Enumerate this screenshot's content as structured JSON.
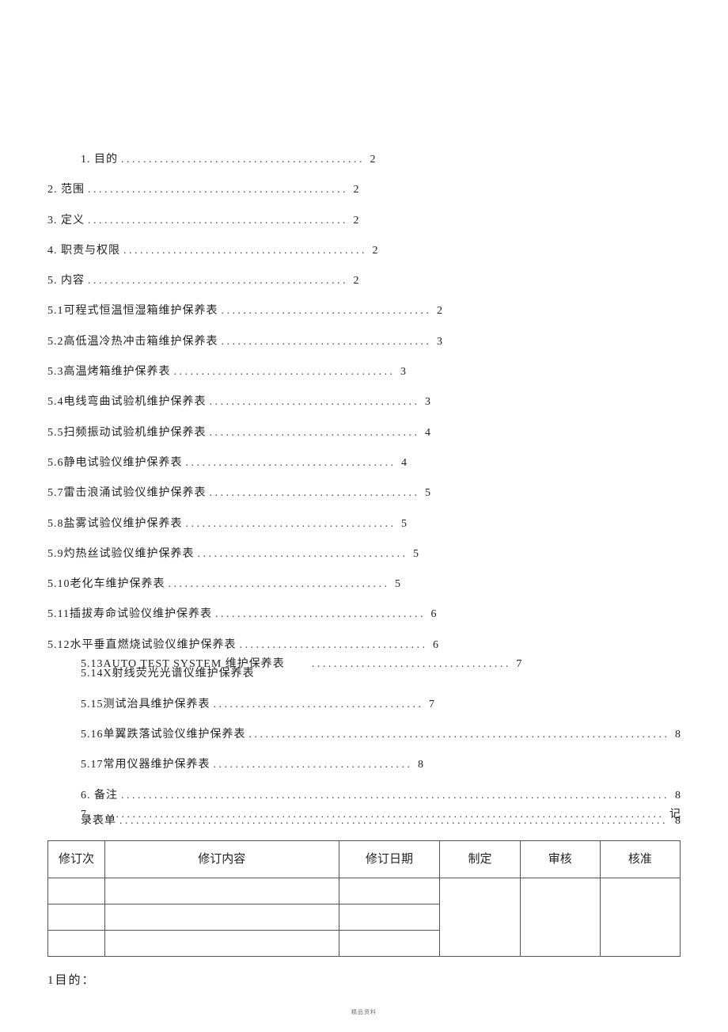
{
  "toc": [
    {
      "label": "1. 目的",
      "page": "2",
      "indent": 1,
      "dotlen": 44
    },
    {
      "label": "2. 范围",
      "page": "2",
      "indent": 0,
      "dotlen": 47
    },
    {
      "label": "3. 定义",
      "page": "2",
      "indent": 0,
      "dotlen": 47
    },
    {
      "label": "4. 职责与权限",
      "page": "2",
      "indent": 0,
      "dotlen": 44
    },
    {
      "label": "5. 内容",
      "page": "2",
      "indent": 0,
      "dotlen": 47
    },
    {
      "label": "5.1可程式恒温恒湿箱维护保养表",
      "page": "2",
      "indent": 0,
      "dotlen": 38
    },
    {
      "label": "5.2高低温冷热冲击箱维护保养表",
      "page": "3",
      "indent": 0,
      "dotlen": 38
    },
    {
      "label": "5.3高温烤箱维护保养表",
      "page": "3",
      "indent": 0,
      "dotlen": 40
    },
    {
      "label": "5.4电线弯曲试验机维护保养表",
      "page": "3",
      "indent": 0,
      "dotlen": 38
    },
    {
      "label": "5.5扫频振动试验机维护保养表",
      "page": "4",
      "indent": 0,
      "dotlen": 38
    },
    {
      "label": "5.6静电试验仪维护保养表",
      "page": "4",
      "indent": 0,
      "dotlen": 38
    },
    {
      "label": "5.7雷击浪涌试验仪维护保养表",
      "page": "5",
      "indent": 0,
      "dotlen": 38
    },
    {
      "label": "5.8盐雾试验仪维护保养表",
      "page": "5",
      "indent": 0,
      "dotlen": 38
    },
    {
      "label": "5.9灼热丝试验仪维护保养表",
      "page": "5",
      "indent": 0,
      "dotlen": 38
    },
    {
      "label": "5.10老化车维护保养表",
      "page": "5",
      "indent": 0,
      "dotlen": 40
    },
    {
      "label": "5.11插拔寿命试验仪维护保养表",
      "page": "6",
      "indent": 0,
      "dotlen": 38
    },
    {
      "label": "5.12水平垂直燃烧试验仪维护保养表",
      "page": "6",
      "indent": 0,
      "dotlen": 34
    },
    {
      "label": "5.13AUTO TEST SYSTEM 维护保养表",
      "page": "7",
      "indent": 2,
      "dotlen": 36,
      "gapAfterLabel": 30
    },
    {
      "label": "5.14X射线荧光光谱仪维护保养表",
      "page": "",
      "indent": 2,
      "dotlen": 0
    },
    {
      "label": "5.15测试治具维护保养表",
      "page": "7",
      "indent": 2,
      "dotlen": 38
    },
    {
      "label": "5.16单翼跌落试验仪维护保养表",
      "page": "8",
      "indent": 2,
      "dotlen": 86
    },
    {
      "label": "5.17常用仪器维护保养表",
      "page": "8",
      "indent": 2,
      "dotlen": 36
    },
    {
      "label": "6. 备注",
      "page": "8",
      "indent": 2,
      "dotlen": 104
    },
    {
      "label": "7.",
      "page": "记",
      "indent": 2,
      "dotlen": 108
    },
    {
      "label": "录表单",
      "page": "8",
      "indent": 2,
      "dotlen": 102
    }
  ],
  "table": {
    "headers": [
      "修订次",
      "修订内容",
      "修订日期",
      "制定",
      "审核",
      "核准"
    ],
    "rows": 3
  },
  "section_heading": "1目的：",
  "footer": "精品资料"
}
